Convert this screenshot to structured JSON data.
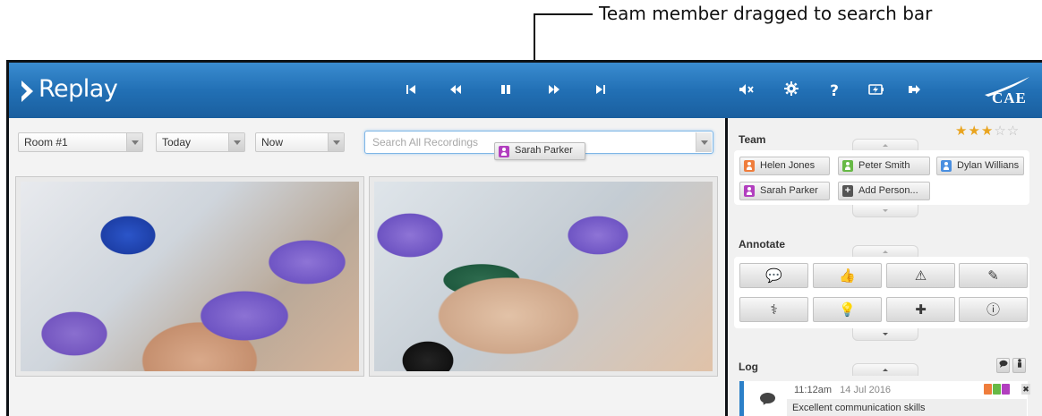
{
  "callout": {
    "text": "Team member dragged to search bar"
  },
  "app": {
    "title": "Replay",
    "brand": "CAE"
  },
  "toolbar": {
    "skip_back": "⏮",
    "rewind": "⏪",
    "pause": "❚❚",
    "fast_forward": "⏩",
    "skip_forward": "⏭",
    "mute_icon": "🔇",
    "settings_icon": "⚙",
    "help_icon": "?",
    "battery_icon": "⚡",
    "logout_icon": "⇥"
  },
  "filters": {
    "room": "Room #1",
    "date": "Today",
    "time": "Now"
  },
  "search": {
    "placeholder": "Search All Recordings",
    "dragged_chip": "Sarah Parker"
  },
  "rating": {
    "value": 3,
    "max": 5,
    "filled": "★★★",
    "empty": "☆☆"
  },
  "team": {
    "title": "Team",
    "members": [
      {
        "name": "Helen Jones",
        "color": "#ef7d3c"
      },
      {
        "name": "Peter Smith",
        "color": "#67b946"
      },
      {
        "name": "Dylan Willians",
        "color": "#4a8fe0"
      },
      {
        "name": "Sarah Parker",
        "color": "#b23fbf"
      }
    ],
    "add_label": "Add Person..."
  },
  "annotate": {
    "title": "Annotate",
    "buttons": [
      "comment-icon",
      "thumbs-up-icon",
      "warning-icon",
      "syringe-icon",
      "stethoscope-icon",
      "lightbulb-icon",
      "first-aid-icon",
      "info-icon"
    ],
    "glyphs": [
      "💬",
      "👍",
      "⚠",
      "✎",
      "⚕",
      "💡",
      "✚",
      "ⓘ"
    ]
  },
  "log": {
    "title": "Log",
    "entries": [
      {
        "time": "11:12am",
        "date": "14 Jul 2016",
        "text": "Excellent communication skills",
        "tags": [
          "#ef7d3c",
          "#67b946",
          "#b23fbf"
        ]
      }
    ]
  }
}
